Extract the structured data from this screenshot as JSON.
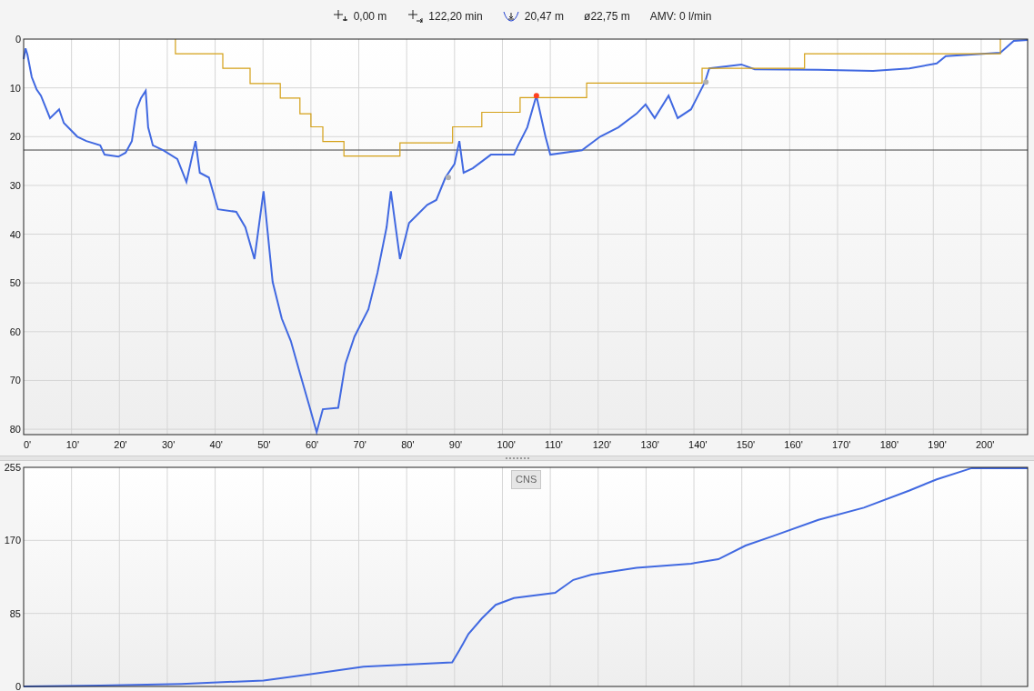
{
  "header": {
    "items": [
      {
        "kind": "start-depth",
        "text": "0,00 m"
      },
      {
        "kind": "duration",
        "text": "122,20 min"
      },
      {
        "kind": "max-depth",
        "text": "20,47 m"
      },
      {
        "kind": "plain",
        "text": "ø22,75 m"
      },
      {
        "kind": "plain",
        "text": "AMV: 0 l/min"
      }
    ]
  },
  "depth_chart": {
    "chart_data": {
      "type": "line",
      "grid": true,
      "xlim": [
        0,
        209.7
      ],
      "ylim": [
        81.1,
        0
      ],
      "xticks": [
        {
          "value": 0,
          "label": "0'"
        },
        {
          "value": 10,
          "label": "10'"
        },
        {
          "value": 20,
          "label": "20'"
        },
        {
          "value": 30,
          "label": "30'"
        },
        {
          "value": 40,
          "label": "40'"
        },
        {
          "value": 50,
          "label": "50'"
        },
        {
          "value": 60,
          "label": "60'"
        },
        {
          "value": 70,
          "label": "70'"
        },
        {
          "value": 80,
          "label": "80'"
        },
        {
          "value": 90,
          "label": "90'"
        },
        {
          "value": 100,
          "label": "100'"
        },
        {
          "value": 110,
          "label": "110'"
        },
        {
          "value": 120,
          "label": "120'"
        },
        {
          "value": 130,
          "label": "130'"
        },
        {
          "value": 140,
          "label": "140'"
        },
        {
          "value": 150,
          "label": "150'"
        },
        {
          "value": 160,
          "label": "160'"
        },
        {
          "value": 170,
          "label": "170'"
        },
        {
          "value": 180,
          "label": "180'"
        },
        {
          "value": 190,
          "label": "190'"
        },
        {
          "value": 200,
          "label": "200'"
        }
      ],
      "yticks": [
        0,
        10,
        20,
        30,
        40,
        50,
        60,
        70,
        80
      ],
      "x": [
        0,
        0.4,
        0.8,
        1.7,
        2.7,
        3.6,
        5.5,
        7.4,
        8.4,
        11.2,
        13.1,
        16,
        16.9,
        19.8,
        21.3,
        22.6,
        23.6,
        24.5,
        25.5,
        26,
        27,
        29.2,
        32.1,
        34,
        35.9,
        36.8,
        38.7,
        40.6,
        44.4,
        46.3,
        48.2,
        50.1,
        52,
        53.9,
        55.8,
        57.7,
        59.6,
        61.2,
        62.5,
        65.7,
        67.2,
        69.1,
        72,
        73.9,
        75.8,
        76.7,
        78.6,
        80.5,
        84.3,
        86.2,
        88.1,
        90,
        91,
        91.9,
        93.8,
        97.6,
        102.4,
        103.3,
        105.2,
        107.1,
        109,
        110,
        116.6,
        120.4,
        124.2,
        128,
        129.9,
        131.8,
        134.7,
        136.6,
        139.4,
        142.3,
        143.2,
        149.9,
        152.7,
        166,
        177.4,
        185,
        190.7,
        192.6,
        204,
        206.8,
        209.7
      ],
      "series": [
        {
          "color": "#4169e1",
          "values": [
            4.1,
            1.9,
            3.2,
            7.8,
            10.3,
            11.6,
            16.2,
            14.4,
            17.2,
            20,
            20.9,
            21.8,
            23.7,
            24.1,
            23.3,
            20.9,
            14.4,
            12.1,
            10.6,
            18.1,
            21.8,
            22.8,
            24.6,
            29.3,
            20.9,
            27.4,
            28.4,
            34.9,
            35.4,
            38.6,
            45.1,
            31.2,
            49.8,
            57.3,
            61.9,
            68.5,
            75,
            80.6,
            75.9,
            75.6,
            66.6,
            61,
            55.4,
            47.9,
            38.6,
            31.2,
            45.1,
            37.7,
            34,
            33,
            28.4,
            25.6,
            20.9,
            27.4,
            26.5,
            23.7,
            23.7,
            21.8,
            18.1,
            11.6,
            20,
            23.7,
            22.8,
            20,
            18.1,
            15.3,
            13.4,
            16.2,
            11.6,
            16.2,
            14.4,
            8.8,
            6,
            5.2,
            6.2,
            6.3,
            6.5,
            6,
            5,
            3.5,
            2.8,
            0.4,
            0.2
          ]
        },
        {
          "color": "#d4a017",
          "x": [
            31.7,
            31.7,
            41.6,
            41.6,
            47.3,
            47.3,
            53.6,
            53.6,
            57.7,
            57.7,
            60,
            60,
            62.5,
            62.5,
            66.9,
            66.9,
            78.6,
            78.6,
            89.6,
            89.6,
            95.7,
            95.7,
            103.7,
            103.7,
            117.6,
            117.6,
            141.7,
            141.7,
            163.1,
            163.1,
            204,
            204
          ],
          "values": [
            0,
            3,
            3,
            6,
            6,
            9.1,
            9.1,
            12.1,
            12.1,
            15.3,
            15.3,
            18,
            18,
            21,
            21,
            24,
            24,
            21.3,
            21.3,
            18,
            18,
            15,
            15,
            12,
            12,
            9,
            9,
            6,
            6,
            3,
            3,
            0
          ]
        },
        {
          "color": "#ff4020",
          "marker": true,
          "x": [
            107.1
          ],
          "values": [
            11.6
          ]
        },
        {
          "color": "#b0b0b0",
          "marker": true,
          "x": [
            88.7
          ],
          "values": [
            28.4
          ]
        },
        {
          "color": "#b0b0b0",
          "marker": true,
          "x": [
            142.5
          ],
          "values": [
            8.8
          ]
        }
      ],
      "ref_lines": [
        {
          "value": 22.75,
          "axis": "y"
        }
      ]
    }
  },
  "cns_chart": {
    "label": "CNS",
    "chart_data": {
      "type": "line",
      "grid": true,
      "xlim": [
        0,
        209.7
      ],
      "ylim": [
        0,
        255
      ],
      "yticks": [
        0,
        85,
        170,
        255
      ],
      "x": [
        0,
        16,
        33,
        50.1,
        59.6,
        71,
        89.5,
        91,
        92.9,
        95.7,
        98.6,
        102.4,
        111,
        114.8,
        118.6,
        128,
        139.4,
        145.1,
        150.8,
        156.5,
        166,
        175.5,
        185,
        190.7,
        198,
        209.7
      ],
      "series": [
        {
          "color": "#4169e1",
          "values": [
            0,
            1,
            3,
            7,
            14,
            23,
            28,
            42,
            61,
            79,
            95,
            103,
            109,
            124,
            130,
            138,
            143,
            148,
            164,
            175,
            194,
            208,
            228,
            241,
            254,
            254
          ]
        }
      ]
    }
  }
}
